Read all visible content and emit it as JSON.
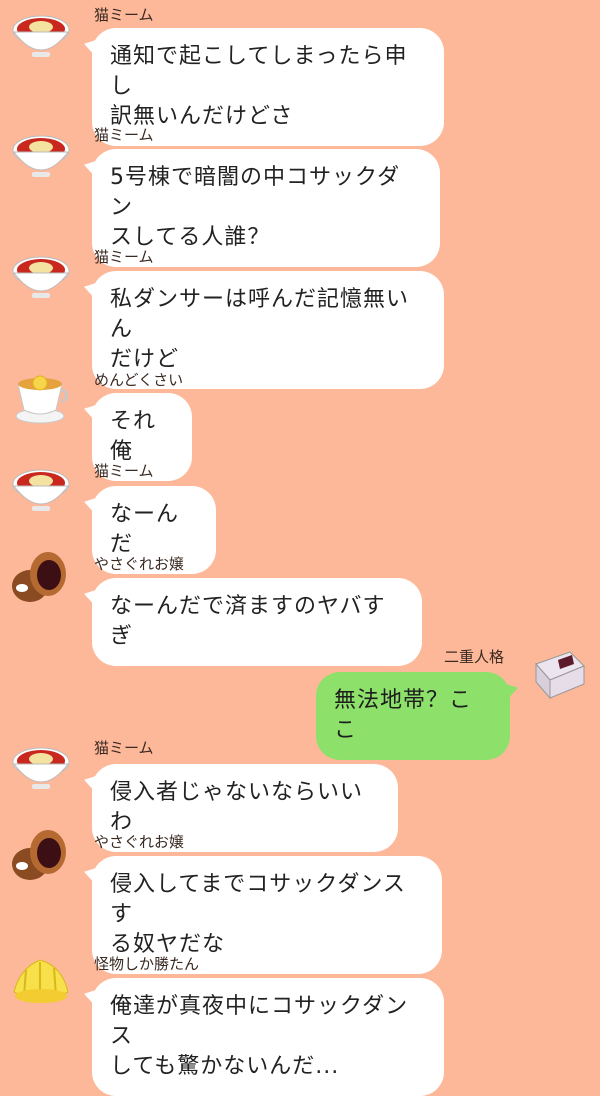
{
  "messages": [
    {
      "sender": "猫ミーム",
      "avatar": "red-noodle-bowl-icon",
      "text": "通知で起こしてしまったら申し\n訳無いんだけどさ",
      "mine": false
    },
    {
      "sender": "猫ミーム",
      "avatar": "red-noodle-bowl-icon",
      "text": "5号棟で暗闇の中コサックダン\nスしてる人誰？",
      "mine": false
    },
    {
      "sender": "猫ミーム",
      "avatar": "red-noodle-bowl-icon",
      "text": "私ダンサーは呼んだ記憶無いん\nだけど",
      "mine": false
    },
    {
      "sender": "めんどくさい",
      "avatar": "lemon-tea-cup-icon",
      "text": "それ俺",
      "mine": false
    },
    {
      "sender": "猫ミーム",
      "avatar": "red-noodle-bowl-icon",
      "text": "なーんだ",
      "mine": false
    },
    {
      "sender": "やさぐれお嬢",
      "avatar": "bean-bun-icon",
      "text": "なーんだで済ますのヤバすぎ",
      "mine": false
    },
    {
      "sender": "二重人格",
      "avatar": "red-bean-cake-icon",
      "text": "無法地帯？ここ",
      "mine": true
    },
    {
      "sender": "猫ミーム",
      "avatar": "red-noodle-bowl-icon",
      "text": "侵入者じゃないならいいわ",
      "mine": false
    },
    {
      "sender": "やさぐれお嬢",
      "avatar": "bean-bun-icon",
      "text": "侵入してまでコサックダンスす\nる奴ヤだな",
      "mine": false
    },
    {
      "sender": "怪物しか勝たん",
      "avatar": "pineapple-icon",
      "text": "俺達が真夜中にコサックダンス\nしても驚かないんだ...",
      "mine": false
    }
  ],
  "colors": {
    "background": "#fdb899",
    "bubble_other": "#ffffff",
    "bubble_mine": "#8de06a"
  }
}
